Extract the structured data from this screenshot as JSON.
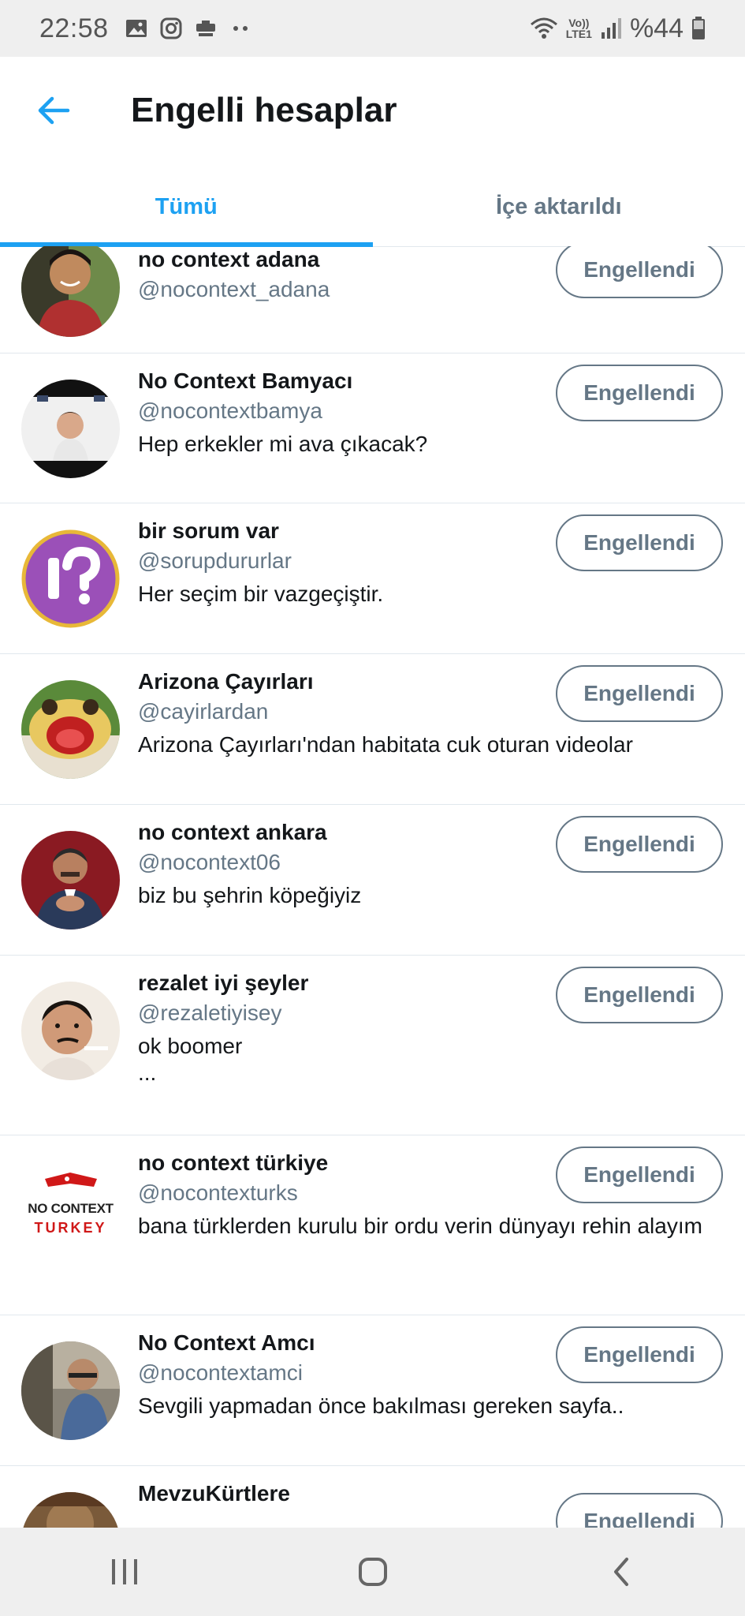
{
  "status_bar": {
    "time": "22:58",
    "battery_text": "%44",
    "network_label_top": "Vo))",
    "network_label_bottom": "LTE1"
  },
  "header": {
    "title": "Engelli hesaplar",
    "accent_color": "#1da1f2"
  },
  "tabs": [
    {
      "label": "Tümü",
      "active": true
    },
    {
      "label": "İçe aktarıldı",
      "active": false
    }
  ],
  "accounts": [
    {
      "name": "no context adana",
      "handle": "@nocontext_adana",
      "bio": "",
      "button": "Engellendi"
    },
    {
      "name": "No Context Bamyacı",
      "handle": "@nocontextbamya",
      "bio": "Hep erkekler mi ava çıkacak?",
      "button": "Engellendi"
    },
    {
      "name": "bir sorum var",
      "handle": "@sorupdururlar",
      "bio": "Her seçim bir vazgeçiştir.",
      "button": "Engellendi"
    },
    {
      "name": "Arizona Çayırları",
      "handle": "@cayirlardan",
      "bio": "Arizona Çayırları'ndan habitata cuk oturan videolar",
      "button": "Engellendi"
    },
    {
      "name": "no context ankara",
      "handle": "@nocontext06",
      "bio": "biz bu şehrin köpeğiyiz",
      "button": "Engellendi"
    },
    {
      "name": "rezalet iyi şeyler",
      "handle": "@rezaletiyisey",
      "bio": "ok boomer",
      "bio_extra": "...",
      "button": "Engellendi"
    },
    {
      "name": "no context türkiye",
      "handle": "@nocontexturks",
      "bio": "bana türklerden kurulu bir ordu verin dünyayı rehin alayım",
      "button": "Engellendi",
      "logo_text_top": "NO CONTEXT",
      "logo_text_bottom": "TURKEY"
    },
    {
      "name": "No Context Amcı",
      "handle": "@nocontextamci",
      "bio": "Sevgili yapmadan önce bakılması gereken sayfa..",
      "button": "Engellendi"
    },
    {
      "name": "MevzuKürtlere",
      "handle": "",
      "bio": "",
      "button": "Engellendi"
    }
  ],
  "icons": {
    "back": "arrow-left-icon",
    "nav_recent": "recent-apps-icon",
    "nav_home": "home-icon",
    "nav_back": "back-chevron-icon"
  }
}
